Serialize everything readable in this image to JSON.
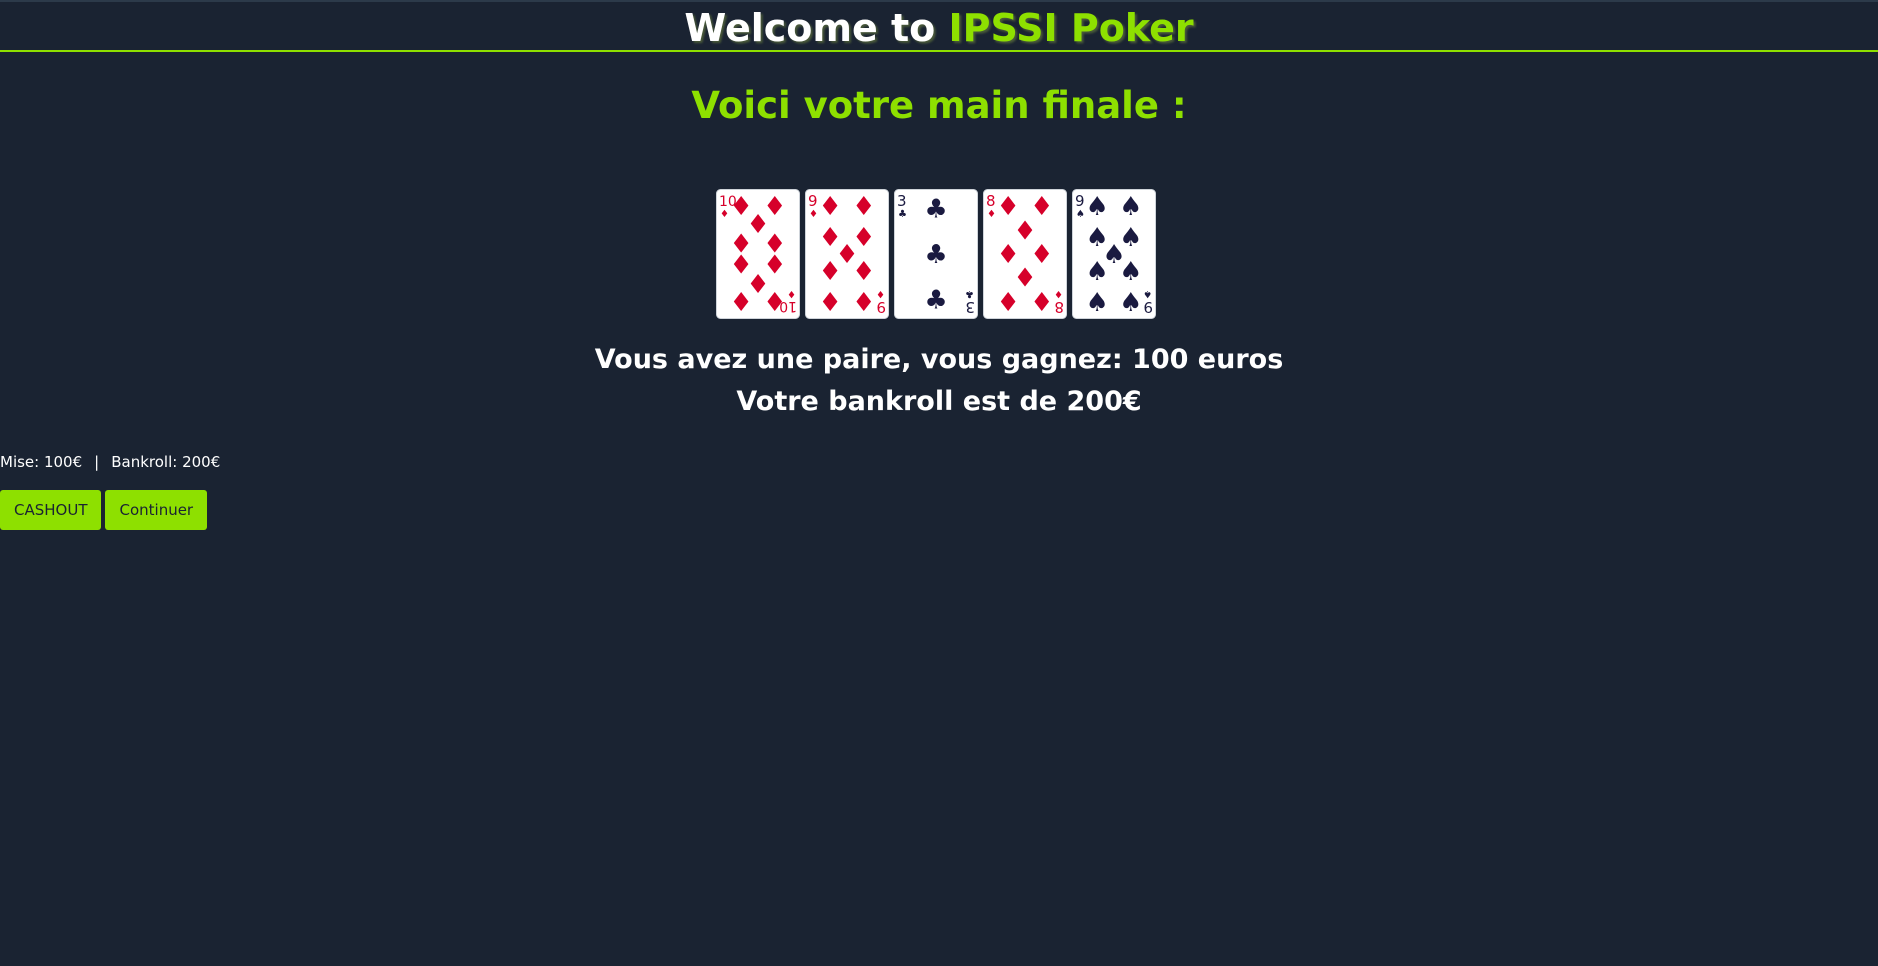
{
  "header": {
    "title_prefix": "Welcome to ",
    "title_brand": "IPSSI Poker"
  },
  "subtitle": "Voici votre main finale :",
  "cards": [
    {
      "rank": "10",
      "suit": "diamonds",
      "color": "#d6002a",
      "name": "card-10-diamonds"
    },
    {
      "rank": "9",
      "suit": "diamonds",
      "color": "#d6002a",
      "name": "card-9-diamonds"
    },
    {
      "rank": "3",
      "suit": "clubs",
      "color": "#1a1a40",
      "name": "card-3-clubs"
    },
    {
      "rank": "8",
      "suit": "diamonds",
      "color": "#d6002a",
      "name": "card-8-diamonds"
    },
    {
      "rank": "9",
      "suit": "spades",
      "color": "#1a1a40",
      "name": "card-9-spades"
    }
  ],
  "result": {
    "line1": "Vous avez une paire, vous gagnez: 100 euros",
    "line2": "Votre bankroll est de 200€"
  },
  "stats": {
    "mise": "Mise: 100€",
    "separator": "|",
    "bankroll": "Bankroll: 200€"
  },
  "buttons": {
    "cashout": "CASHOUT",
    "continue": "Continuer"
  },
  "colors": {
    "background": "#1a2332",
    "accent": "#8ee000",
    "red_suit": "#d6002a",
    "black_suit": "#1a1a40"
  }
}
